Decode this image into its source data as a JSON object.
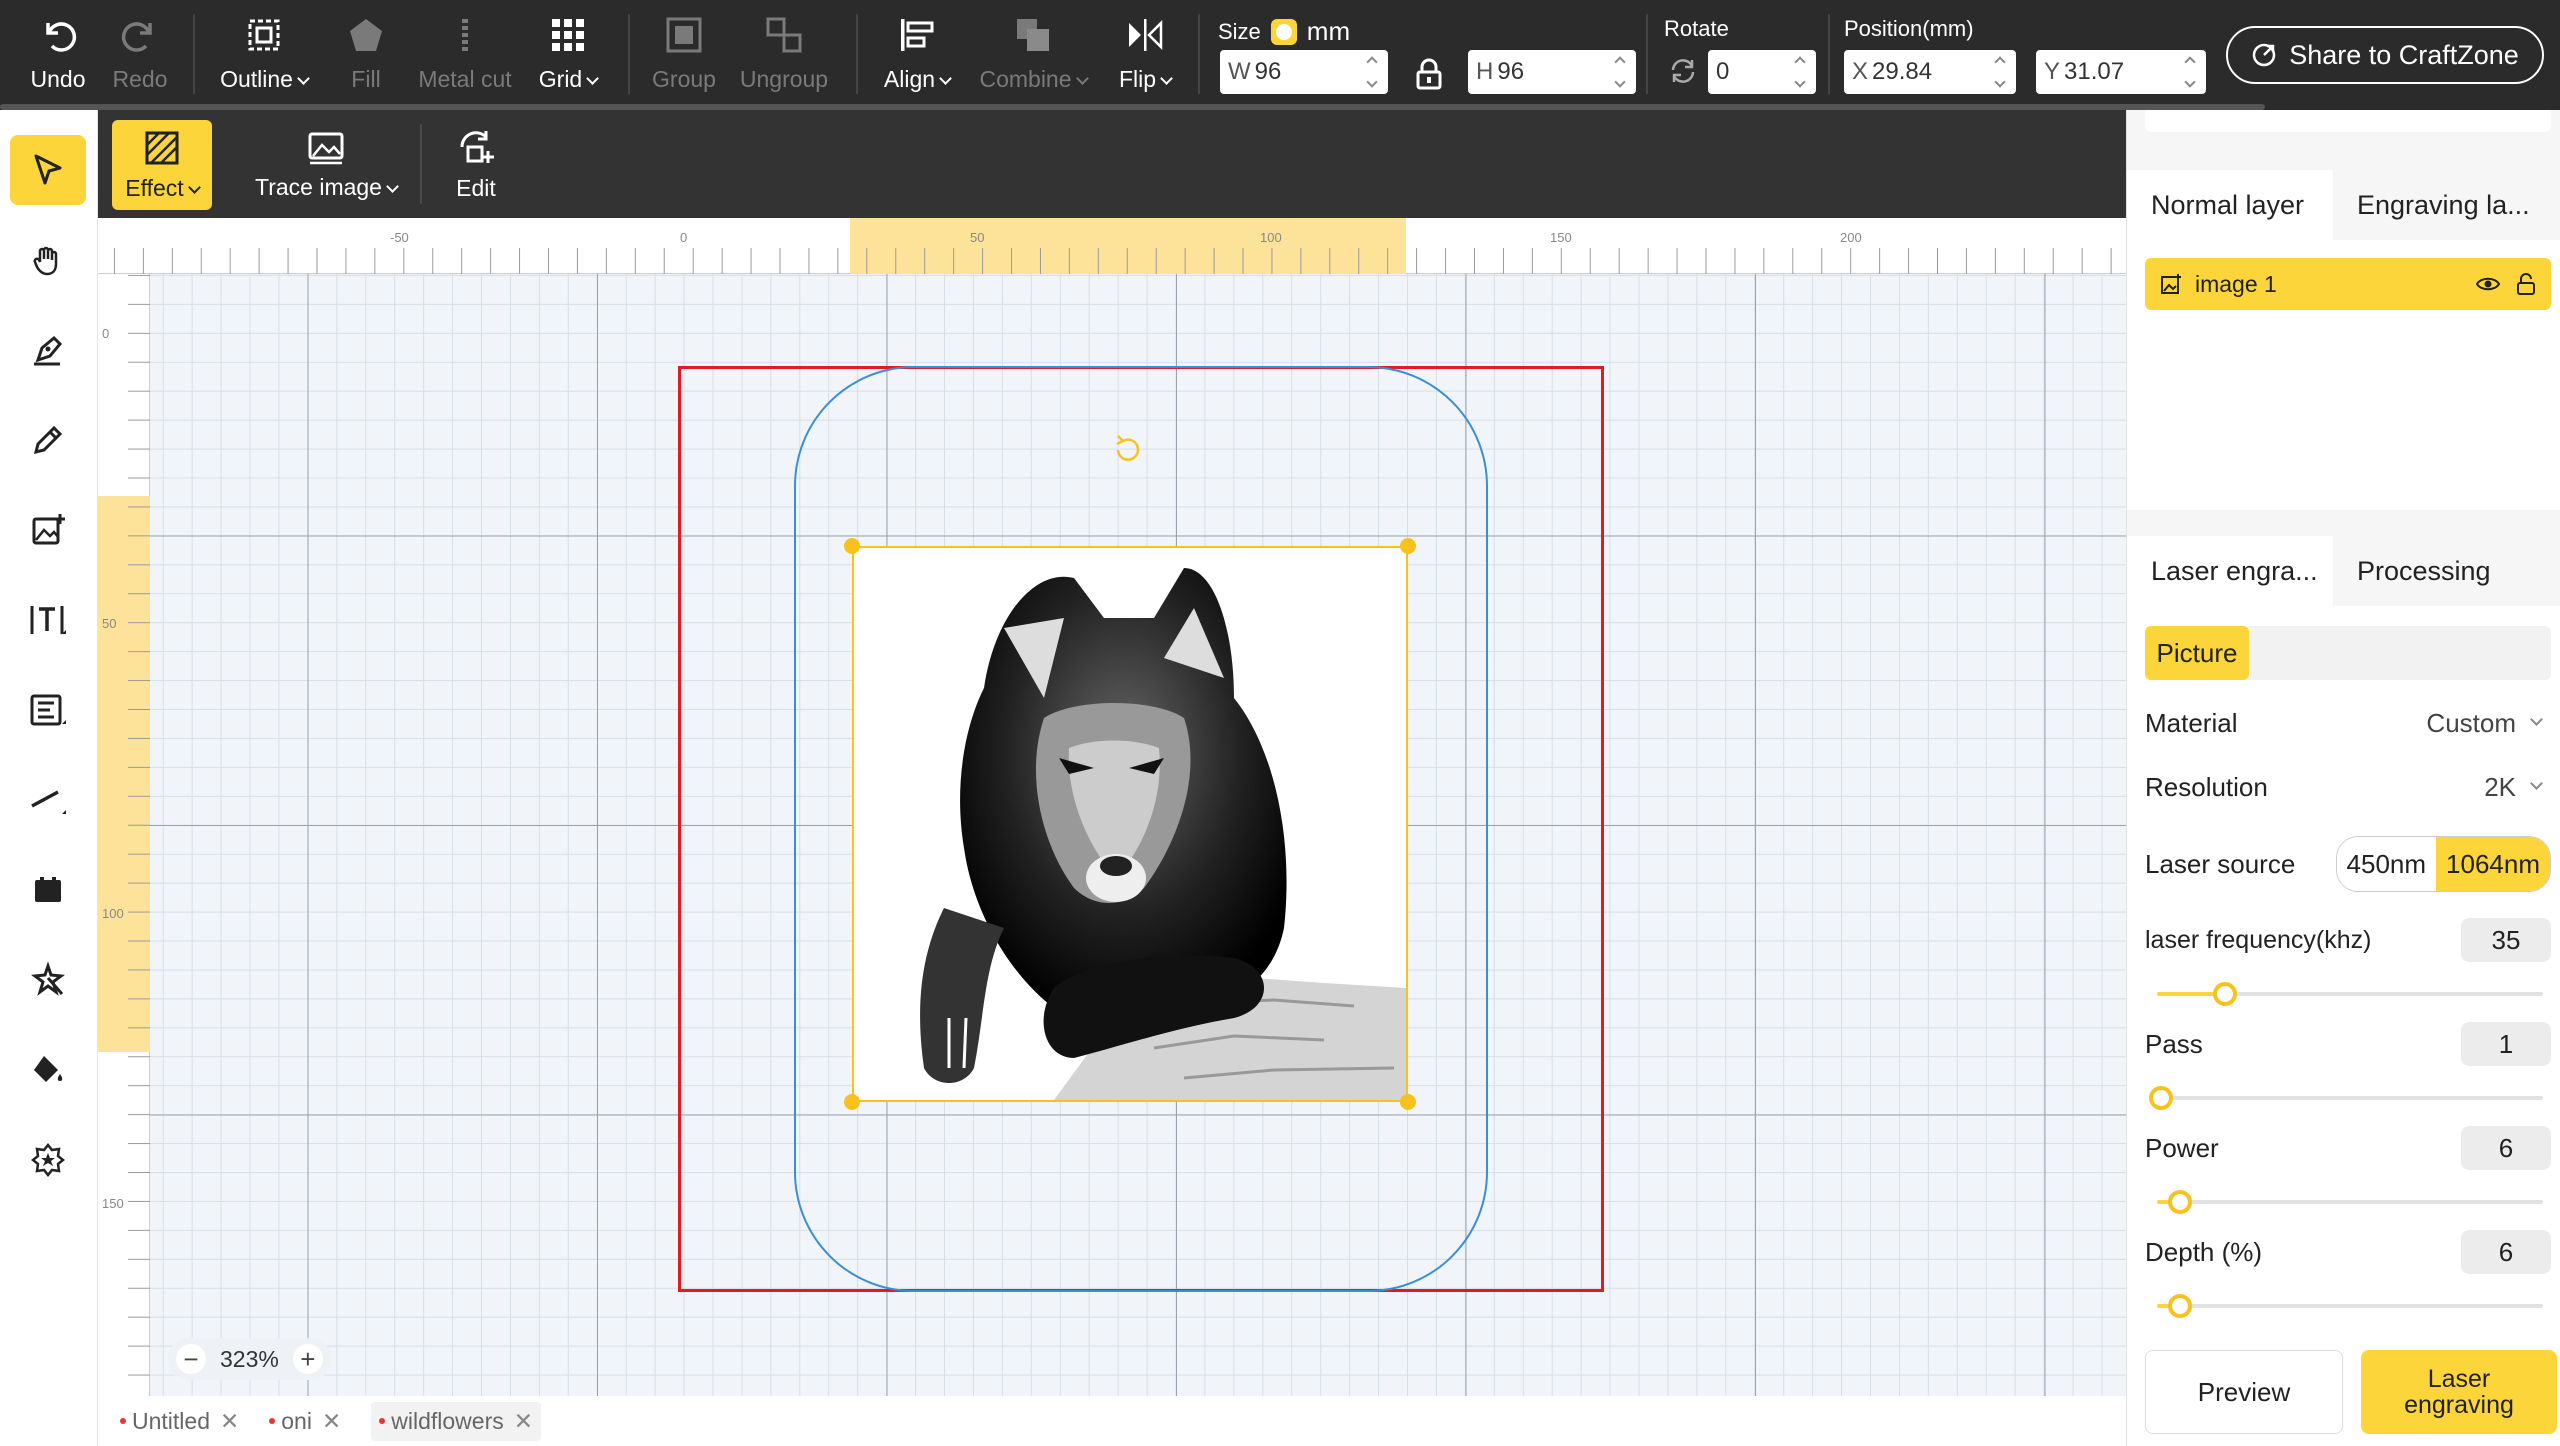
{
  "toolbar": {
    "undo": "Undo",
    "redo": "Redo",
    "outline": "Outline",
    "fill": "Fill",
    "metal_cut": "Metal cut",
    "grid": "Grid",
    "group": "Group",
    "ungroup": "Ungroup",
    "align": "Align",
    "combine": "Combine",
    "flip": "Flip",
    "size_label": "Size",
    "unit": "mm",
    "width_prefix": "W",
    "width": "96",
    "height_prefix": "H",
    "height": "96",
    "rotate_label": "Rotate",
    "rotate": "0",
    "position_label": "Position(mm)",
    "x_prefix": "X",
    "x": "29.84",
    "y_prefix": "Y",
    "y": "31.07",
    "share": "Share to CraftZone"
  },
  "subbar": {
    "effect": "Effect",
    "trace_image": "Trace image",
    "edit": "Edit"
  },
  "ruler": {
    "top": [
      "-50",
      "0",
      "50",
      "100",
      "150",
      "200"
    ],
    "left": [
      "0",
      "50",
      "100",
      "150"
    ]
  },
  "canvas": {
    "zoom": "323%",
    "zoom_out": "−",
    "zoom_in": "+"
  },
  "doc_tabs": [
    "Untitled",
    "oni",
    "wildflowers"
  ],
  "right_panel": {
    "layer_tabs": [
      "Normal layer",
      "Engraving la..."
    ],
    "layer_name": "image 1",
    "process_tabs": [
      "Laser engra...",
      "Processing"
    ],
    "mode": "Picture",
    "material_label": "Material",
    "material_value": "Custom",
    "resolution_label": "Resolution",
    "resolution_value": "2K",
    "laser_source_label": "Laser source",
    "laser_source_options": [
      "450nm",
      "1064nm"
    ],
    "laser_source_selected": "1064nm",
    "frequency_label": "laser frequency(khz)",
    "frequency": "35",
    "pass_label": "Pass",
    "pass": "1",
    "power_label": "Power",
    "power": "6",
    "depth_label": "Depth (%)",
    "depth": "6",
    "preview": "Preview",
    "engrave_line1": "Laser",
    "engrave_line2": "engraving"
  },
  "colors": {
    "accent": "#fbd53a",
    "toolbar_bg": "#2b2b2b",
    "work_area": "#e01b24",
    "outline": "#3a8fd4"
  }
}
